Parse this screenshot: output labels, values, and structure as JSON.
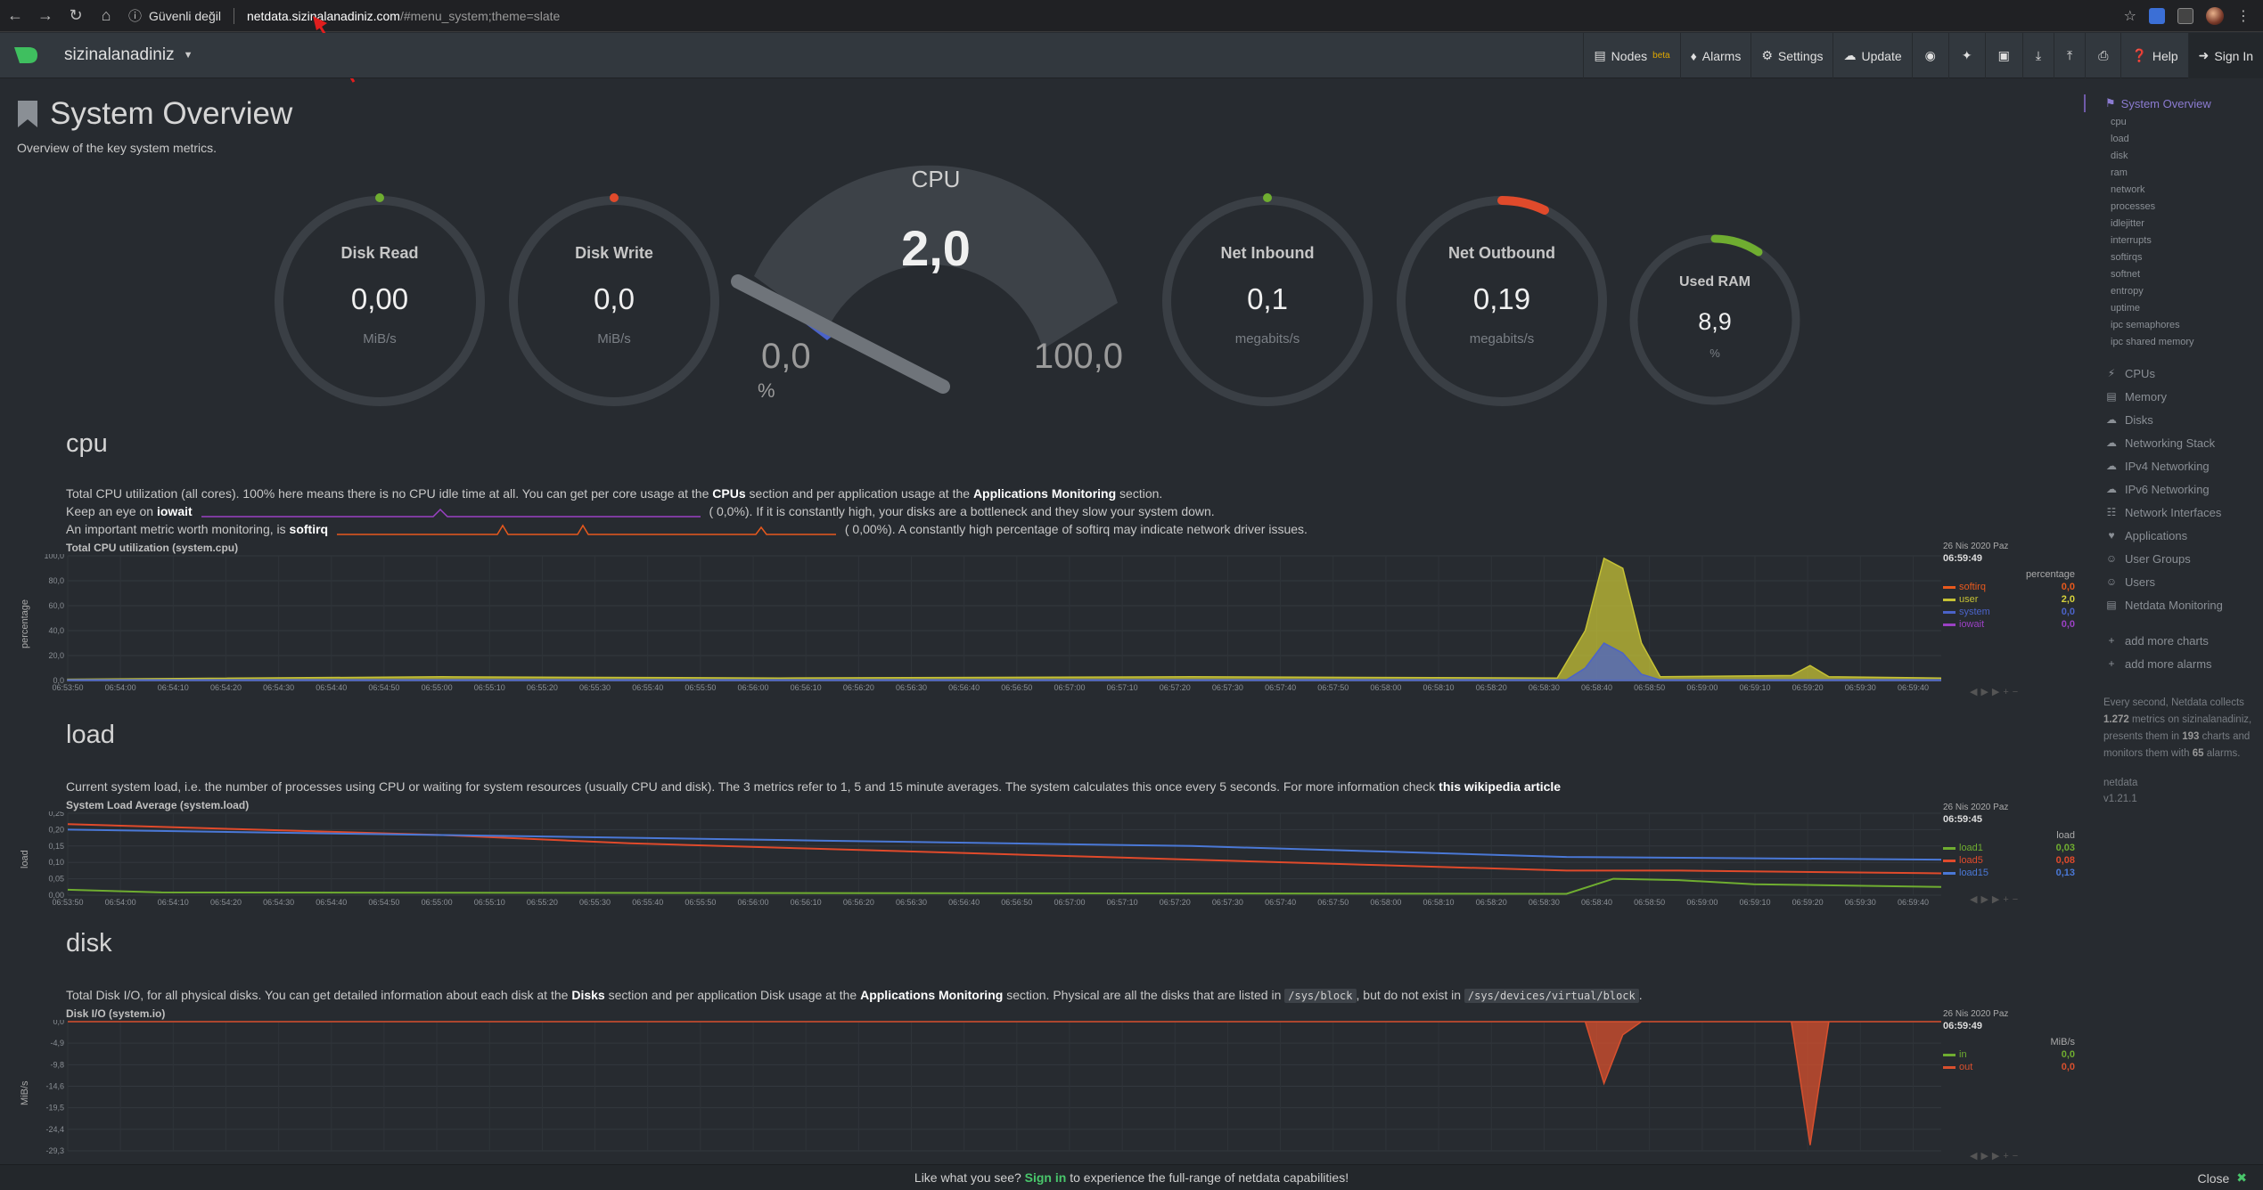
{
  "browser": {
    "security": "Güvenli değil",
    "host": "netdata.sizinalanadiniz.com",
    "path": "/#menu_system;theme=slate"
  },
  "navbar": {
    "host": "sizinalanadiniz",
    "nodes": "Nodes",
    "nodes_badge": "beta",
    "alarms": "Alarms",
    "settings": "Settings",
    "update": "Update",
    "help": "Help",
    "signin": "Sign In"
  },
  "page": {
    "title": "System Overview",
    "subtitle": "Overview of the key system metrics."
  },
  "gauges": {
    "disk_read": {
      "label": "Disk Read",
      "value": "0,00",
      "unit": "MiB/s",
      "level": 0.0
    },
    "disk_write": {
      "label": "Disk Write",
      "value": "0,0",
      "unit": "MiB/s",
      "level": 0.0
    },
    "cpu": {
      "title": "CPU",
      "value": "2,0",
      "min": "0,0",
      "max": "100,0",
      "unit": "%",
      "level": 0.02
    },
    "net_in": {
      "label": "Net Inbound",
      "value": "0,1",
      "unit": "megabits/s",
      "level": 0.0
    },
    "net_out": {
      "label": "Net Outbound",
      "value": "0,19",
      "unit": "megabits/s",
      "level": 0.08
    },
    "ram": {
      "label": "Used RAM",
      "value": "8,9",
      "unit": "%",
      "level": 0.089
    }
  },
  "colors": {
    "softirq": "#e8591d",
    "user": "#c6c235",
    "system": "#4b63c9",
    "iowait": "#9b41c4",
    "load1": "#6fad30",
    "load5": "#e04a2b",
    "load15": "#4a78d6",
    "in": "#6fad30",
    "out": "#d8502e"
  },
  "cpu_section": {
    "title": "cpu",
    "desc1_a": "Total CPU utilization (all cores). 100% here means there is no CPU idle time at all. You can get per core usage at the ",
    "desc1_b": "CPUs",
    "desc1_c": " section and per application usage at the ",
    "desc1_d": "Applications Monitoring",
    "desc1_e": " section.",
    "desc2_a": "Keep an eye on ",
    "desc2_b": "iowait",
    "desc2_c": "(        0,0%). If it is constantly high, your disks are a bottleneck and they slow your system down.",
    "desc3_a": "An important metric worth monitoring, is ",
    "desc3_b": "softirq",
    "desc3_c": "(        0,00%). A constantly high percentage of softirq may indicate network driver issues.",
    "chart_title": "Total CPU utilization (system.cpu)",
    "y_title": "percentage",
    "legend_date": "26 Nis 2020 Paz",
    "legend_time": "06:59:49",
    "legend_unit": "percentage",
    "series": [
      {
        "name": "softirq",
        "value": "0,0"
      },
      {
        "name": "user",
        "value": "2,0"
      },
      {
        "name": "system",
        "value": "0,0"
      },
      {
        "name": "iowait",
        "value": "0,0"
      }
    ]
  },
  "load_section": {
    "title": "load",
    "desc_a": "Current system load, i.e. the number of processes using CPU or waiting for system resources (usually CPU and disk). The 3 metrics refer to 1, 5 and 15 minute averages. The system calculates this once every 5 seconds. For more information check ",
    "desc_b": "this wikipedia article",
    "chart_title": "System Load Average (system.load)",
    "y_title": "load",
    "legend_date": "26 Nis 2020 Paz",
    "legend_time": "06:59:45",
    "legend_unit": "load",
    "series": [
      {
        "name": "load1",
        "value": "0,03"
      },
      {
        "name": "load5",
        "value": "0,08"
      },
      {
        "name": "load15",
        "value": "0,13"
      }
    ]
  },
  "disk_section": {
    "title": "disk",
    "desc_a": "Total Disk I/O, for all physical disks. You can get detailed information about each disk at the ",
    "desc_b": "Disks",
    "desc_c": " section and per application Disk usage at the ",
    "desc_d": "Applications Monitoring",
    "desc_e": " section. Physical are all the disks that are listed in ",
    "desc_f": "/sys/block",
    "desc_g": ", but do not exist in ",
    "desc_h": "/sys/devices/virtual/block",
    "desc_i": ".",
    "chart_title": "Disk I/O (system.io)",
    "y_title": "MiB/s",
    "legend_date": "26 Nis 2020 Paz",
    "legend_time": "06:59:49",
    "legend_unit": "MiB/s",
    "series": [
      {
        "name": "in",
        "value": "0,0"
      },
      {
        "name": "out",
        "value": "0,0"
      }
    ]
  },
  "chart_data": [
    {
      "type": "area",
      "title": "Total CPU utilization (system.cpu)",
      "ylabel": "percentage",
      "ylim": [
        0,
        100
      ],
      "yticks": [
        "100,0",
        "80,0",
        "60,0",
        "40,0",
        "20,0",
        "0,0"
      ],
      "xticks": [
        "06:53:50",
        "06:54:00",
        "06:54:10",
        "06:54:20",
        "06:54:30",
        "06:54:40",
        "06:54:50",
        "06:55:00",
        "06:55:10",
        "06:55:20",
        "06:55:30",
        "06:55:40",
        "06:55:50",
        "06:56:00",
        "06:56:10",
        "06:56:20",
        "06:56:30",
        "06:56:40",
        "06:56:50",
        "06:57:00",
        "06:57:10",
        "06:57:20",
        "06:57:30",
        "06:57:40",
        "06:57:50",
        "06:58:00",
        "06:58:10",
        "06:58:20",
        "06:58:30",
        "06:58:40",
        "06:58:50",
        "06:59:00",
        "06:59:10",
        "06:59:20",
        "06:59:30",
        "06:59:40"
      ],
      "series": [
        {
          "name": "user",
          "points": [
            [
              0,
              1
            ],
            [
              0.2,
              3
            ],
            [
              0.38,
              2
            ],
            [
              0.6,
              3
            ],
            [
              0.795,
              2
            ],
            [
              0.81,
              40
            ],
            [
              0.82,
              98
            ],
            [
              0.83,
              90
            ],
            [
              0.84,
              30
            ],
            [
              0.85,
              3
            ],
            [
              0.92,
              4
            ],
            [
              0.93,
              12
            ],
            [
              0.94,
              3
            ],
            [
              1,
              2
            ]
          ]
        },
        {
          "name": "system",
          "points": [
            [
              0,
              0.5
            ],
            [
              0.8,
              0.5
            ],
            [
              0.81,
              10
            ],
            [
              0.82,
              30
            ],
            [
              0.83,
              22
            ],
            [
              0.84,
              5
            ],
            [
              0.85,
              0.5
            ],
            [
              1,
              0.5
            ]
          ]
        }
      ]
    },
    {
      "type": "line",
      "title": "System Load Average (system.load)",
      "ylabel": "load",
      "ylim": [
        0,
        0.3
      ],
      "yticks": [
        "0,25",
        "0,20",
        "0,15",
        "0,10",
        "0,05",
        "0,00"
      ],
      "xticks": [
        "06:53:50",
        "06:54:00",
        "06:54:10",
        "06:54:20",
        "06:54:30",
        "06:54:40",
        "06:54:50",
        "06:55:00",
        "06:55:10",
        "06:55:20",
        "06:55:30",
        "06:55:40",
        "06:55:50",
        "06:56:00",
        "06:56:10",
        "06:56:20",
        "06:56:30",
        "06:56:40",
        "06:56:50",
        "06:57:00",
        "06:57:10",
        "06:57:20",
        "06:57:30",
        "06:57:40",
        "06:57:50",
        "06:58:00",
        "06:58:10",
        "06:58:20",
        "06:58:30",
        "06:58:40",
        "06:58:50",
        "06:59:00",
        "06:59:10",
        "06:59:20",
        "06:59:30",
        "06:59:40"
      ],
      "series": [
        {
          "name": "load1",
          "points": [
            [
              0,
              0.02
            ],
            [
              0.05,
              0.01
            ],
            [
              0.8,
              0.005
            ],
            [
              0.825,
              0.06
            ],
            [
              0.86,
              0.055
            ],
            [
              0.9,
              0.04
            ],
            [
              1,
              0.03
            ]
          ]
        },
        {
          "name": "load5",
          "points": [
            [
              0,
              0.26
            ],
            [
              0.1,
              0.24
            ],
            [
              0.2,
              0.22
            ],
            [
              0.3,
              0.19
            ],
            [
              0.4,
              0.17
            ],
            [
              0.5,
              0.15
            ],
            [
              0.6,
              0.13
            ],
            [
              0.7,
              0.11
            ],
            [
              0.8,
              0.09
            ],
            [
              0.86,
              0.09
            ],
            [
              1,
              0.08
            ]
          ]
        },
        {
          "name": "load15",
          "points": [
            [
              0,
              0.24
            ],
            [
              0.2,
              0.22
            ],
            [
              0.4,
              0.2
            ],
            [
              0.6,
              0.18
            ],
            [
              0.7,
              0.16
            ],
            [
              0.8,
              0.14
            ],
            [
              1,
              0.13
            ]
          ]
        }
      ]
    },
    {
      "type": "area",
      "title": "Disk I/O (system.io)",
      "ylabel": "MiB/s",
      "ylim": [
        -29.3,
        0
      ],
      "yticks": [
        "0,0",
        "-4,9",
        "-9,8",
        "-14,6",
        "-19,5",
        "-24,4",
        "-29,3"
      ],
      "xticks": [],
      "series": [
        {
          "name": "out",
          "points": [
            [
              0,
              0
            ],
            [
              0.81,
              0
            ],
            [
              0.82,
              -14
            ],
            [
              0.83,
              -3
            ],
            [
              0.84,
              0
            ],
            [
              0.92,
              0
            ],
            [
              0.93,
              -28
            ],
            [
              0.94,
              0
            ],
            [
              1,
              0
            ]
          ]
        }
      ]
    }
  ],
  "sidebar": {
    "active": "System Overview",
    "subitems": [
      "cpu",
      "load",
      "disk",
      "ram",
      "network",
      "processes",
      "idlejitter",
      "interrupts",
      "softirqs",
      "softnet",
      "entropy",
      "uptime",
      "ipc semaphores",
      "ipc shared memory"
    ],
    "sections": [
      "CPUs",
      "Memory",
      "Disks",
      "Networking Stack",
      "IPv4 Networking",
      "IPv6 Networking",
      "Network Interfaces",
      "Applications",
      "User Groups",
      "Users",
      "Netdata Monitoring"
    ],
    "add_charts": "add more charts",
    "add_alarms": "add more alarms",
    "info_a": "Every second, Netdata collects ",
    "info_metrics": "1.272",
    "info_b": " metrics on sizinalanadiniz, presents them in ",
    "info_charts": "193",
    "info_c": " charts and monitors them with ",
    "info_alarms": "65",
    "info_d": " alarms.",
    "brand": "netdata",
    "version": "v1.21.1"
  },
  "banner": {
    "text_a": "Like what you see? ",
    "text_b": "Sign in",
    "text_c": " to experience the full-range of netdata capabilities!",
    "close": "Close"
  }
}
